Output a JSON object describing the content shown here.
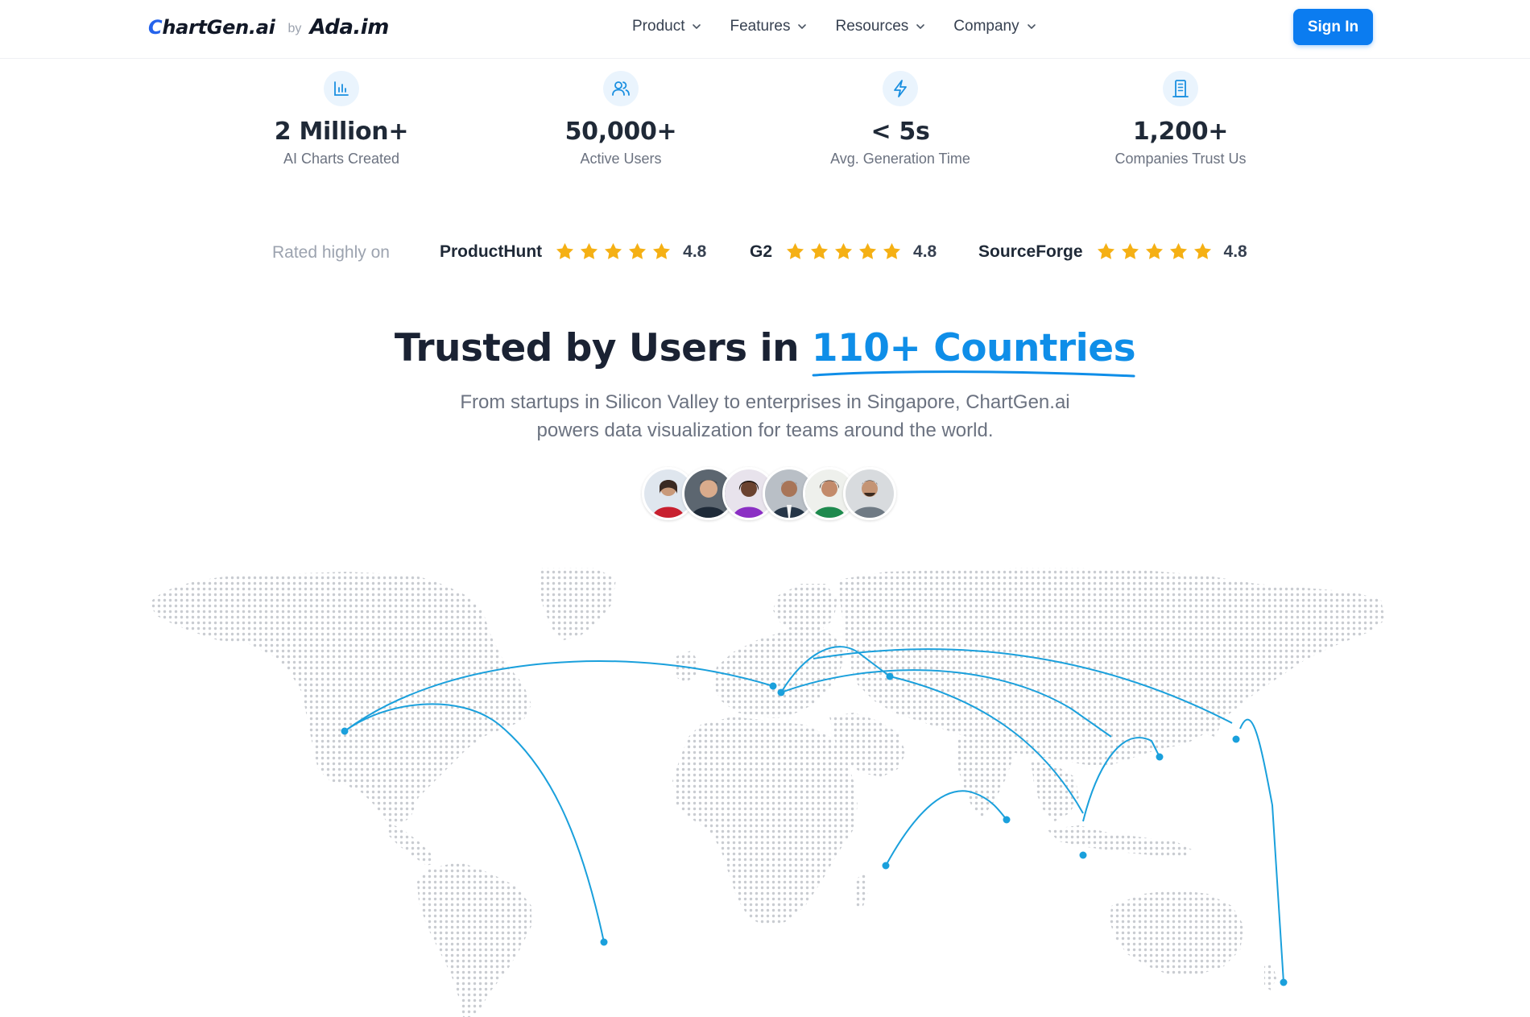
{
  "brand": {
    "name_prefix": "C",
    "name_rest": "hartGen.ai",
    "by": "by",
    "parent": "Ada.im"
  },
  "nav": [
    {
      "label": "Product"
    },
    {
      "label": "Features"
    },
    {
      "label": "Resources"
    },
    {
      "label": "Company"
    }
  ],
  "signin": {
    "label": "Sign In"
  },
  "stats": [
    {
      "value": "2 Million+",
      "label": "AI Charts Created",
      "icon": "bar-chart-icon"
    },
    {
      "value": "50,000+",
      "label": "Active Users",
      "icon": "users-icon"
    },
    {
      "value": "< 5s",
      "label": "Avg. Generation Time",
      "icon": "lightning-icon"
    },
    {
      "value": "1,200+",
      "label": "Companies Trust Us",
      "icon": "building-icon"
    }
  ],
  "ratings": {
    "label": "Rated highly on",
    "items": [
      {
        "platform": "ProductHunt",
        "score": "4.8",
        "stars": 5
      },
      {
        "platform": "G2",
        "score": "4.8",
        "stars": 5
      },
      {
        "platform": "SourceForge",
        "score": "4.8",
        "stars": 5
      }
    ]
  },
  "headline": {
    "main": "Trusted by Users in ",
    "accent": "110+ Countries"
  },
  "subtext": {
    "line1": "From startups in Silicon Valley to enterprises in Singapore, ChartGen.ai",
    "line2": "powers data visualization for teams around the world."
  },
  "colors": {
    "accent": "#0f8ee8",
    "button": "#0b7cf0",
    "star": "#f5b014",
    "map_dot": "#c9ccd1",
    "arc": "#1aa0dc"
  }
}
